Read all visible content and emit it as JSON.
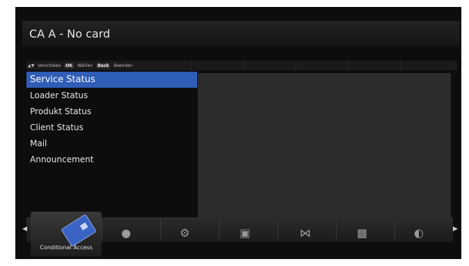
{
  "header": {
    "title": "CA A - No card"
  },
  "hints": [
    {
      "icon": "▲▼",
      "label": "Verschiebe"
    },
    {
      "key": "OK",
      "label": "Wählen"
    },
    {
      "key": "Back",
      "label": "Beenden"
    }
  ],
  "menu": {
    "items": [
      {
        "label": "Service Status",
        "selected": true
      },
      {
        "label": "Loader Status"
      },
      {
        "label": "Produkt Status"
      },
      {
        "label": "Client Status"
      },
      {
        "label": "Mail"
      },
      {
        "label": "Announcement"
      }
    ]
  },
  "iconbar": {
    "selected_label": "Conditional Access",
    "icons": [
      "globe-icon",
      "gear-icon",
      "tv-icon",
      "lock-icon",
      "folder-icon",
      "satellite-dish-icon"
    ],
    "arrow_left": "◀",
    "arrow_right": "▶"
  }
}
